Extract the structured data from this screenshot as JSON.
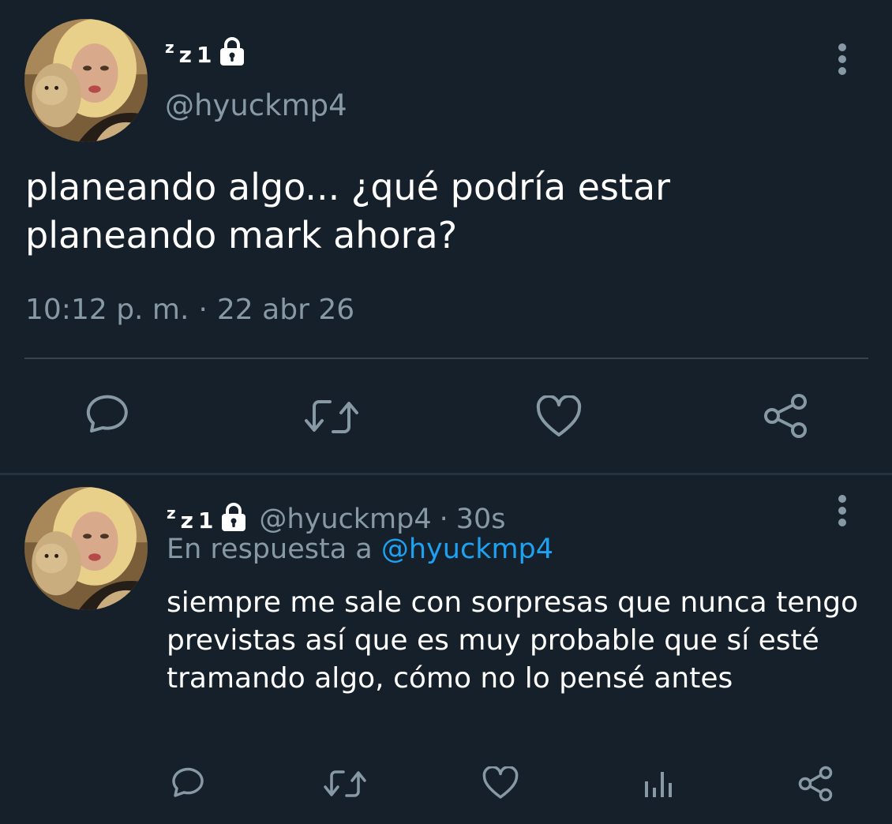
{
  "colors": {
    "background": "#15202b",
    "text_primary": "#ffffff",
    "text_secondary": "#8899a6",
    "link": "#1da1f2",
    "divider": "#38444d"
  },
  "main_tweet": {
    "display_name": {
      "z_small": "z",
      "z_large": "z",
      "one": "1"
    },
    "lock_icon": "lock-icon",
    "handle": "@hyuckmp4",
    "text": "planeando algo... ¿qué podría estar planeando mark ahora?",
    "time": "10:12 p. m.",
    "separator": "·",
    "date": "22 abr 26",
    "actions": [
      "reply-icon",
      "retweet-icon",
      "like-icon",
      "share-icon"
    ]
  },
  "reply_tweet": {
    "display_name": {
      "z_small": "z",
      "z_large": "z",
      "one": "1"
    },
    "lock_icon": "lock-icon",
    "handle": "@hyuckmp4",
    "separator": "·",
    "time": "30s",
    "in_reply_to_prefix": "En respuesta a",
    "in_reply_to_handle": "@hyuckmp4",
    "text": "siempre me sale con sorpresas que nunca tengo previstas así que es muy probable que sí esté tramando algo, cómo no lo pensé antes",
    "actions": [
      "reply-icon",
      "retweet-icon",
      "like-icon",
      "analytics-icon",
      "share-icon"
    ]
  }
}
